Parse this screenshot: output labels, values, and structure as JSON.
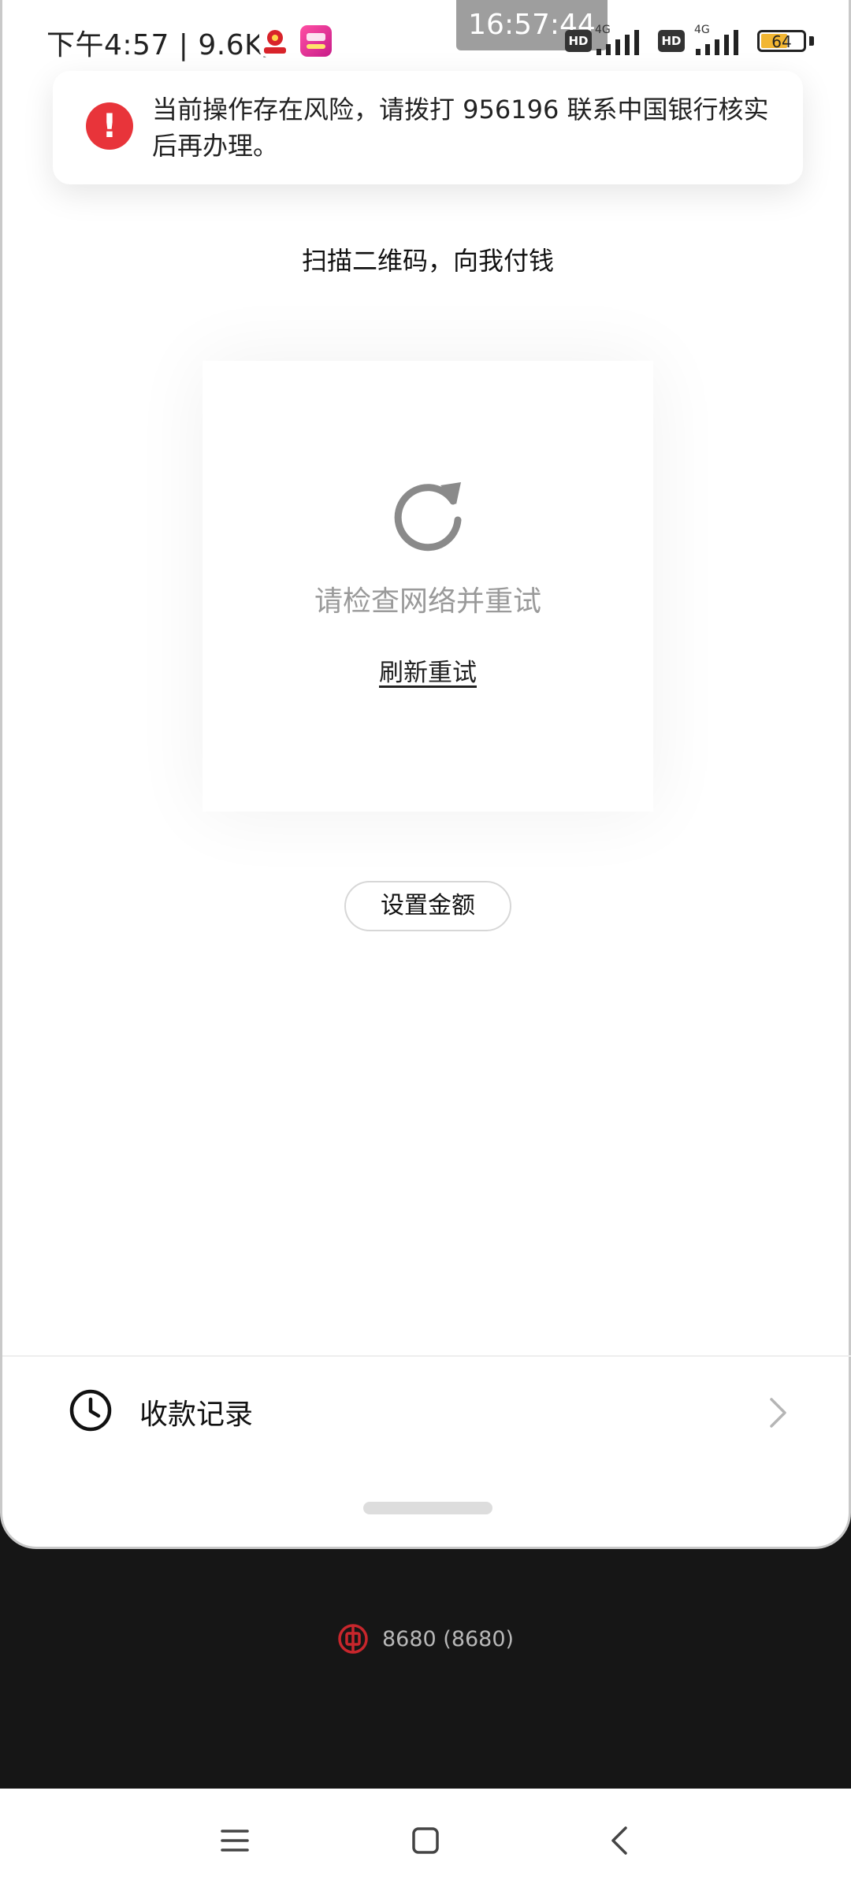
{
  "status_bar": {
    "time_speed": "下午4:57 | 9.6K/s",
    "clock": "16:57:44",
    "hd": "HD",
    "net_type": "4G",
    "battery_level": 64,
    "battery_label": "64"
  },
  "alert": {
    "icon": "exclamation-icon",
    "message": "当前操作存在风险，请拨打 956196 联系中国银行核实后再办理。",
    "accent_color": "#e8343a"
  },
  "page": {
    "title": "扫描二维码，向我付钱"
  },
  "qr_card": {
    "icon": "refresh-icon",
    "error_text": "请检查网络并重试",
    "retry_label": "刷新重试"
  },
  "amount_button": {
    "label": "设置金额"
  },
  "records": {
    "icon": "clock-icon",
    "label": "收款记录",
    "chevron": "chevron-right-icon"
  },
  "account": {
    "icon": "boc-logo-icon",
    "text": "8680 (8680)",
    "brand_color": "#c8262c"
  },
  "nav_bar": {
    "icons": [
      "menu-icon",
      "home-icon",
      "back-icon"
    ]
  }
}
